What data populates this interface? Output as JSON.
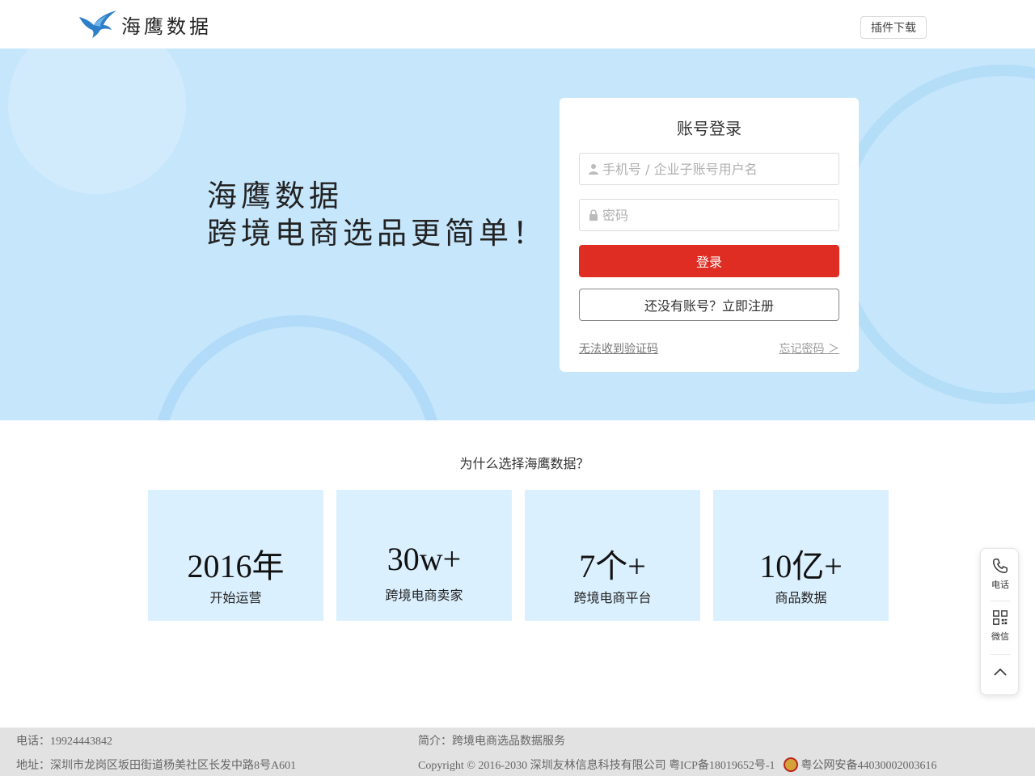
{
  "header": {
    "logo_text": "海鹰数据",
    "plugin_label": "插件下载"
  },
  "hero": {
    "slogan_line1": "海鹰数据",
    "slogan_line2": "跨境电商选品更简单！"
  },
  "login": {
    "title": "账号登录",
    "username_placeholder": "手机号 / 企业子账号用户名",
    "password_placeholder": "密码",
    "login_label": "登录",
    "register_label": "还没有账号？立即注册",
    "no_code_link": "无法收到验证码",
    "forgot_link": "忘记密码 ＞"
  },
  "why": {
    "title": "为什么选择海鹰数据？",
    "stats": [
      {
        "num": "2016年",
        "label": "开始运营"
      },
      {
        "num": "30w+",
        "label": "跨境电商卖家"
      },
      {
        "num": "7个+",
        "label": "跨境电商平台"
      },
      {
        "num": "10亿+",
        "label": "商品数据"
      }
    ]
  },
  "side": {
    "phone_label": "电话",
    "wechat_label": "微信"
  },
  "footer": {
    "phone": "电话：19924443842",
    "address": "地址：深圳市龙岗区坂田街道杨美社区长发中路8号A601",
    "intro": "简介：跨境电商选品数据服务",
    "copyright": "Copyright © 2016-2030 深圳友林信息科技有限公司   粤ICP备18019652号-1",
    "police": "粤公网安备44030002003616"
  },
  "colors": {
    "accent": "#e02d24",
    "hero_bg": "#c5e6fb",
    "stat_bg": "#dbf0fe",
    "logo_blue": "#2f7fc8"
  },
  "icons": [
    "eagle-logo-icon",
    "user-icon",
    "lock-icon",
    "phone-icon",
    "qrcode-icon",
    "chevron-up-icon",
    "police-badge-icon"
  ]
}
